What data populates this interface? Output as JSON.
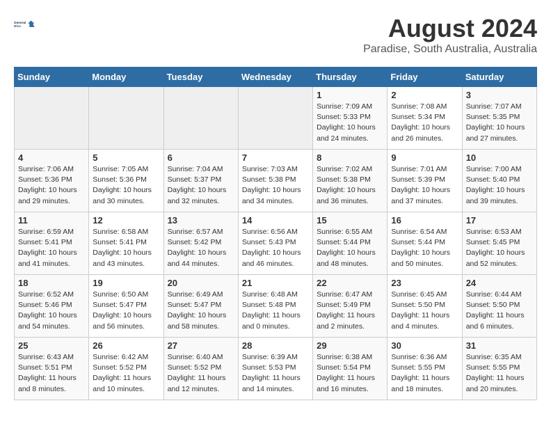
{
  "header": {
    "logo_general": "General",
    "logo_blue": "Blue",
    "month_year": "August 2024",
    "location": "Paradise, South Australia, Australia"
  },
  "days_of_week": [
    "Sunday",
    "Monday",
    "Tuesday",
    "Wednesday",
    "Thursday",
    "Friday",
    "Saturday"
  ],
  "weeks": [
    [
      {
        "day": "",
        "sunrise": "",
        "sunset": "",
        "daylight": "",
        "empty": true
      },
      {
        "day": "",
        "sunrise": "",
        "sunset": "",
        "daylight": "",
        "empty": true
      },
      {
        "day": "",
        "sunrise": "",
        "sunset": "",
        "daylight": "",
        "empty": true
      },
      {
        "day": "",
        "sunrise": "",
        "sunset": "",
        "daylight": "",
        "empty": true
      },
      {
        "day": "1",
        "sunrise": "7:09 AM",
        "sunset": "5:33 PM",
        "daylight": "10 hours and 24 minutes."
      },
      {
        "day": "2",
        "sunrise": "7:08 AM",
        "sunset": "5:34 PM",
        "daylight": "10 hours and 26 minutes."
      },
      {
        "day": "3",
        "sunrise": "7:07 AM",
        "sunset": "5:35 PM",
        "daylight": "10 hours and 27 minutes."
      }
    ],
    [
      {
        "day": "4",
        "sunrise": "7:06 AM",
        "sunset": "5:36 PM",
        "daylight": "10 hours and 29 minutes."
      },
      {
        "day": "5",
        "sunrise": "7:05 AM",
        "sunset": "5:36 PM",
        "daylight": "10 hours and 30 minutes."
      },
      {
        "day": "6",
        "sunrise": "7:04 AM",
        "sunset": "5:37 PM",
        "daylight": "10 hours and 32 minutes."
      },
      {
        "day": "7",
        "sunrise": "7:03 AM",
        "sunset": "5:38 PM",
        "daylight": "10 hours and 34 minutes."
      },
      {
        "day": "8",
        "sunrise": "7:02 AM",
        "sunset": "5:38 PM",
        "daylight": "10 hours and 36 minutes."
      },
      {
        "day": "9",
        "sunrise": "7:01 AM",
        "sunset": "5:39 PM",
        "daylight": "10 hours and 37 minutes."
      },
      {
        "day": "10",
        "sunrise": "7:00 AM",
        "sunset": "5:40 PM",
        "daylight": "10 hours and 39 minutes."
      }
    ],
    [
      {
        "day": "11",
        "sunrise": "6:59 AM",
        "sunset": "5:41 PM",
        "daylight": "10 hours and 41 minutes."
      },
      {
        "day": "12",
        "sunrise": "6:58 AM",
        "sunset": "5:41 PM",
        "daylight": "10 hours and 43 minutes."
      },
      {
        "day": "13",
        "sunrise": "6:57 AM",
        "sunset": "5:42 PM",
        "daylight": "10 hours and 44 minutes."
      },
      {
        "day": "14",
        "sunrise": "6:56 AM",
        "sunset": "5:43 PM",
        "daylight": "10 hours and 46 minutes."
      },
      {
        "day": "15",
        "sunrise": "6:55 AM",
        "sunset": "5:44 PM",
        "daylight": "10 hours and 48 minutes."
      },
      {
        "day": "16",
        "sunrise": "6:54 AM",
        "sunset": "5:44 PM",
        "daylight": "10 hours and 50 minutes."
      },
      {
        "day": "17",
        "sunrise": "6:53 AM",
        "sunset": "5:45 PM",
        "daylight": "10 hours and 52 minutes."
      }
    ],
    [
      {
        "day": "18",
        "sunrise": "6:52 AM",
        "sunset": "5:46 PM",
        "daylight": "10 hours and 54 minutes."
      },
      {
        "day": "19",
        "sunrise": "6:50 AM",
        "sunset": "5:47 PM",
        "daylight": "10 hours and 56 minutes."
      },
      {
        "day": "20",
        "sunrise": "6:49 AM",
        "sunset": "5:47 PM",
        "daylight": "10 hours and 58 minutes."
      },
      {
        "day": "21",
        "sunrise": "6:48 AM",
        "sunset": "5:48 PM",
        "daylight": "11 hours and 0 minutes."
      },
      {
        "day": "22",
        "sunrise": "6:47 AM",
        "sunset": "5:49 PM",
        "daylight": "11 hours and 2 minutes."
      },
      {
        "day": "23",
        "sunrise": "6:45 AM",
        "sunset": "5:50 PM",
        "daylight": "11 hours and 4 minutes."
      },
      {
        "day": "24",
        "sunrise": "6:44 AM",
        "sunset": "5:50 PM",
        "daylight": "11 hours and 6 minutes."
      }
    ],
    [
      {
        "day": "25",
        "sunrise": "6:43 AM",
        "sunset": "5:51 PM",
        "daylight": "11 hours and 8 minutes."
      },
      {
        "day": "26",
        "sunrise": "6:42 AM",
        "sunset": "5:52 PM",
        "daylight": "11 hours and 10 minutes."
      },
      {
        "day": "27",
        "sunrise": "6:40 AM",
        "sunset": "5:52 PM",
        "daylight": "11 hours and 12 minutes."
      },
      {
        "day": "28",
        "sunrise": "6:39 AM",
        "sunset": "5:53 PM",
        "daylight": "11 hours and 14 minutes."
      },
      {
        "day": "29",
        "sunrise": "6:38 AM",
        "sunset": "5:54 PM",
        "daylight": "11 hours and 16 minutes."
      },
      {
        "day": "30",
        "sunrise": "6:36 AM",
        "sunset": "5:55 PM",
        "daylight": "11 hours and 18 minutes."
      },
      {
        "day": "31",
        "sunrise": "6:35 AM",
        "sunset": "5:55 PM",
        "daylight": "11 hours and 20 minutes."
      }
    ]
  ]
}
